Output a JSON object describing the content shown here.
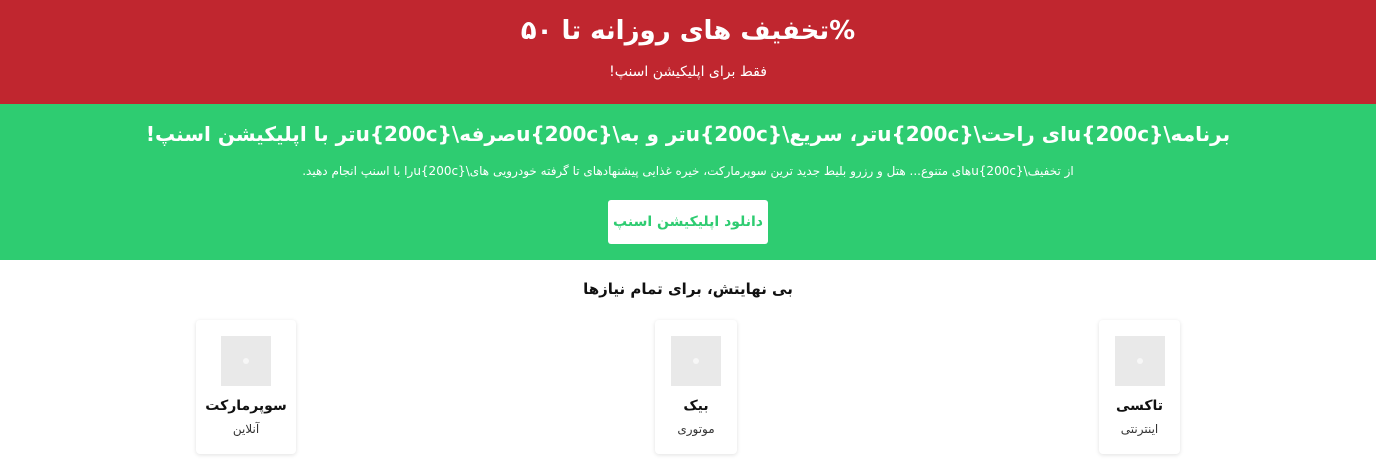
{
  "promo": {
    "title": "%تخفیف های روزانه تا ۵۰",
    "subtitle": "فقط برای اپلیکیشن اسنپ!"
  },
  "app_banner": {
    "heading": "برنامه\\u{200c}ای راحت\\u{200c}تر، سریع\\u{200c}تر و به\\u{200c}صرفه\\u{200c}تر با اپلیکیشن اسنپ!",
    "description": "از تخفیف\\u{200c}های متنوع... هتل و رزرو بلیط جدید ترین سوپرمارکت، خیره غذایی پیشنهادهای تا گرفته خودرویی های\\u{200c}را با اسنپ انجام دهید.",
    "download_label": "دانلود اپلیکیشن اسنپ"
  },
  "services": {
    "title": "بی نهایتش، برای تمام نیازها",
    "items": [
      {
        "name": "تاکسی",
        "sub": "اینترنتی"
      },
      {
        "name": "بیک",
        "sub": "موتوری"
      },
      {
        "name": "سوپرمارکت",
        "sub": "آنلاین"
      }
    ]
  },
  "colors": {
    "promo_bg": "#c0262f",
    "app_bg": "#2ecc71",
    "button_text": "#2ecc71"
  }
}
